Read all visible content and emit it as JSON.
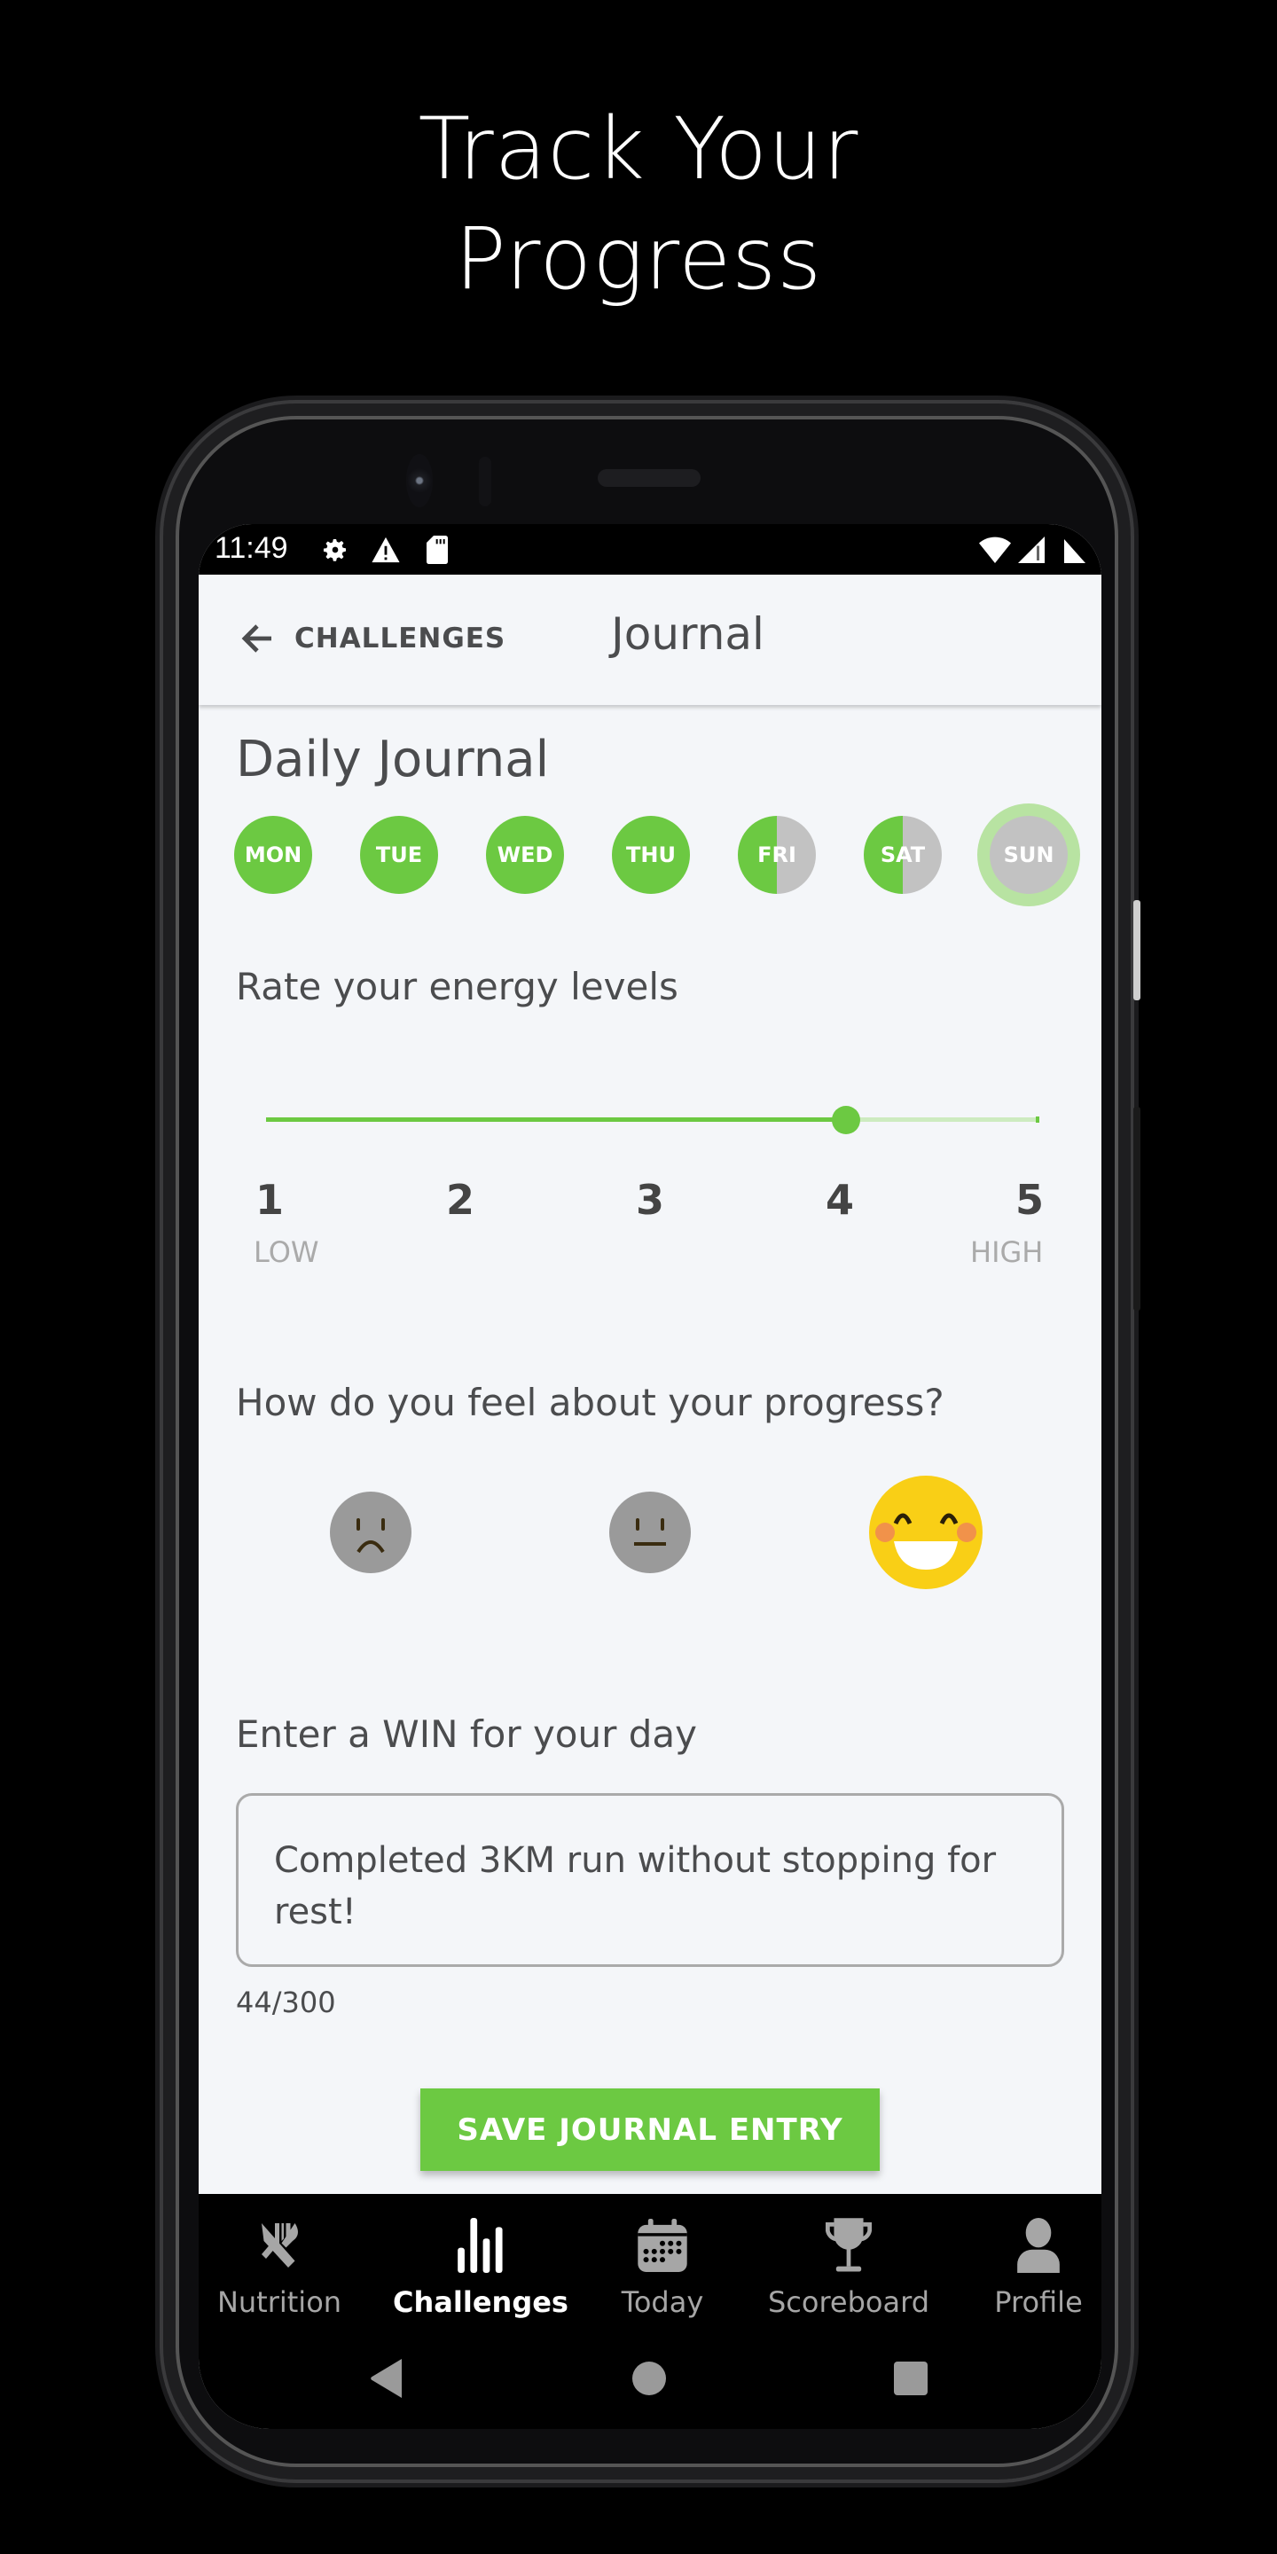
{
  "promo": {
    "line1": "Track Your",
    "line2": "Progress"
  },
  "status_bar": {
    "time": "11:49",
    "icons_left": [
      "settings-icon",
      "warning-icon",
      "sd-card-icon"
    ],
    "icons_right": [
      "wifi-icon",
      "signal-icon",
      "battery-icon"
    ]
  },
  "app_bar": {
    "back_label": "CHALLENGES",
    "title": "Journal"
  },
  "journal": {
    "title": "Daily Journal",
    "days": [
      {
        "label": "MON",
        "status": "complete"
      },
      {
        "label": "TUE",
        "status": "complete"
      },
      {
        "label": "WED",
        "status": "complete"
      },
      {
        "label": "THU",
        "status": "complete"
      },
      {
        "label": "FRI",
        "status": "partial"
      },
      {
        "label": "SAT",
        "status": "partial"
      },
      {
        "label": "SUN",
        "status": "current"
      }
    ],
    "energy": {
      "question": "Rate your energy levels",
      "value": 4,
      "min": 1,
      "max": 5,
      "ticks": [
        "1",
        "2",
        "3",
        "4",
        "5"
      ],
      "low_label": "LOW",
      "high_label": "HIGH"
    },
    "progress": {
      "question": "How do you feel about your progress?",
      "options": [
        "sad",
        "neutral",
        "happy"
      ],
      "selected": "happy"
    },
    "win": {
      "label": "Enter a WIN for your day",
      "value": "Completed 3KM run without stopping for rest!",
      "counter": "44/300"
    },
    "save_label": "SAVE JOURNAL ENTRY"
  },
  "bottom_nav": {
    "items": [
      {
        "label": "Nutrition",
        "icon": "utensils-icon",
        "active": false
      },
      {
        "label": "Challenges",
        "icon": "bar-chart-icon",
        "active": true
      },
      {
        "label": "Today",
        "icon": "calendar-icon",
        "active": false
      },
      {
        "label": "Scoreboard",
        "icon": "trophy-icon",
        "active": false
      },
      {
        "label": "Profile",
        "icon": "person-icon",
        "active": false
      }
    ]
  },
  "colors": {
    "accent": "#6cc942",
    "accent_light": "#b8e3a2",
    "inactive": "#c2c2c2",
    "text": "#4b4c4e",
    "background": "#f4f6f9",
    "happy": "#f9cf16"
  }
}
